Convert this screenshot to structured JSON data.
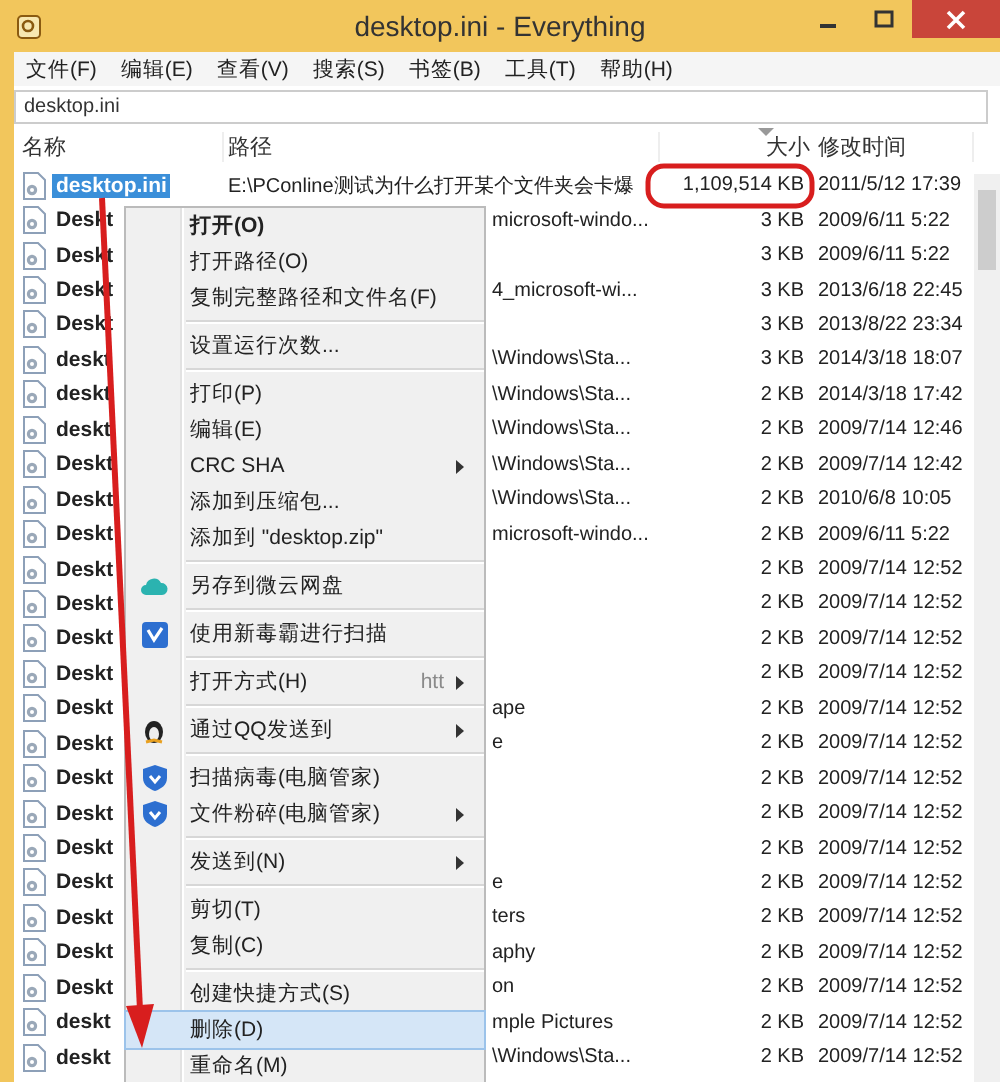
{
  "window": {
    "title": "desktop.ini - Everything"
  },
  "menu_bar": [
    "文件(F)",
    "编辑(E)",
    "查看(V)",
    "搜索(S)",
    "书签(B)",
    "工具(T)",
    "帮助(H)"
  ],
  "search": {
    "value": "desktop.ini"
  },
  "columns": [
    "名称",
    "路径",
    "大小",
    "修改时间"
  ],
  "rows": [
    {
      "name": "desktop.ini",
      "path": "E:\\PConline测试为什么打开某个文件夹会卡爆",
      "size": "1,109,514 KB",
      "modified": "2011/5/12 17:39",
      "selected": true
    },
    {
      "name": "Deskt",
      "path": "microsoft-windo...",
      "size": "3 KB",
      "modified": "2009/6/11 5:22",
      "selected": false
    },
    {
      "name": "Deskt",
      "size": "3 KB",
      "modified": "2009/6/11 5:22",
      "selected": false
    },
    {
      "name": "Deskt",
      "path": "4_microsoft-wi...",
      "size": "3 KB",
      "modified": "2013/6/18 22:45",
      "selected": false
    },
    {
      "name": "Deskt",
      "size": "3 KB",
      "modified": "2013/8/22 23:34",
      "selected": false
    },
    {
      "name": "deskt",
      "path": "\\Windows\\Sta...",
      "size": "3 KB",
      "modified": "2014/3/18 18:07",
      "selected": false
    },
    {
      "name": "deskt",
      "path": "\\Windows\\Sta...",
      "size": "2 KB",
      "modified": "2014/3/18 17:42",
      "selected": false
    },
    {
      "name": "deskt",
      "path": "\\Windows\\Sta...",
      "size": "2 KB",
      "modified": "2009/7/14 12:46",
      "selected": false
    },
    {
      "name": "Deskt",
      "path": "\\Windows\\Sta...",
      "size": "2 KB",
      "modified": "2009/7/14 12:42",
      "selected": false
    },
    {
      "name": "Deskt",
      "path": "\\Windows\\Sta...",
      "size": "2 KB",
      "modified": "2010/6/8 10:05",
      "selected": false
    },
    {
      "name": "Deskt",
      "path": "microsoft-windo...",
      "size": "2 KB",
      "modified": "2009/6/11 5:22",
      "selected": false
    },
    {
      "name": "Deskt",
      "size": "2 KB",
      "modified": "2009/7/14 12:52",
      "selected": false
    },
    {
      "name": "Deskt",
      "size": "2 KB",
      "modified": "2009/7/14 12:52",
      "selected": false
    },
    {
      "name": "Deskt",
      "size": "2 KB",
      "modified": "2009/7/14 12:52",
      "selected": false
    },
    {
      "name": "Deskt",
      "size": "2 KB",
      "modified": "2009/7/14 12:52",
      "selected": false
    },
    {
      "name": "Deskt",
      "path": "ape",
      "size": "2 KB",
      "modified": "2009/7/14 12:52",
      "selected": false
    },
    {
      "name": "Deskt",
      "path": "e",
      "size": "2 KB",
      "modified": "2009/7/14 12:52",
      "selected": false
    },
    {
      "name": "Deskt",
      "size": "2 KB",
      "modified": "2009/7/14 12:52",
      "selected": false
    },
    {
      "name": "Deskt",
      "size": "2 KB",
      "modified": "2009/7/14 12:52",
      "selected": false
    },
    {
      "name": "Deskt",
      "size": "2 KB",
      "modified": "2009/7/14 12:52",
      "selected": false
    },
    {
      "name": "Deskt",
      "path": "e",
      "size": "2 KB",
      "modified": "2009/7/14 12:52",
      "selected": false
    },
    {
      "name": "Deskt",
      "path": "ters",
      "size": "2 KB",
      "modified": "2009/7/14 12:52",
      "selected": false
    },
    {
      "name": "Deskt",
      "path": "aphy",
      "size": "2 KB",
      "modified": "2009/7/14 12:52",
      "selected": false
    },
    {
      "name": "Deskt",
      "path": "on",
      "size": "2 KB",
      "modified": "2009/7/14 12:52",
      "selected": false
    },
    {
      "name": "deskt",
      "path": "mple Pictures",
      "size": "2 KB",
      "modified": "2009/7/14 12:52",
      "selected": false
    },
    {
      "name": "deskt",
      "path": "\\Windows\\Sta...",
      "size": "2 KB",
      "modified": "2009/7/14 12:52",
      "selected": false
    }
  ],
  "context_menu": [
    {
      "kind": "item",
      "label": "打开(O)",
      "default": true,
      "submenu": false,
      "selected": false
    },
    {
      "kind": "item",
      "label": "打开路径(O)",
      "default": false,
      "submenu": false,
      "selected": false
    },
    {
      "kind": "item",
      "label": "复制完整路径和文件名(F)",
      "default": false,
      "submenu": false,
      "selected": false
    },
    {
      "kind": "separator"
    },
    {
      "kind": "item",
      "label": "设置运行次数...",
      "default": false,
      "submenu": false,
      "selected": false
    },
    {
      "kind": "separator"
    },
    {
      "kind": "item",
      "label": "打印(P)",
      "default": false,
      "submenu": false,
      "selected": false
    },
    {
      "kind": "item",
      "label": "编辑(E)",
      "default": false,
      "submenu": false,
      "selected": false
    },
    {
      "kind": "item",
      "label": "CRC SHA",
      "default": false,
      "submenu": true,
      "selected": false
    },
    {
      "kind": "item",
      "label": "添加到压缩包...",
      "default": false,
      "submenu": false,
      "selected": false
    },
    {
      "kind": "item",
      "label": "添加到 \"desktop.zip\"",
      "default": false,
      "submenu": false,
      "selected": false
    },
    {
      "kind": "separator"
    },
    {
      "kind": "cloud-item",
      "label": "另存到微云网盘",
      "default": false,
      "submenu": false,
      "selected": false
    },
    {
      "kind": "separator"
    },
    {
      "kind": "scan-item",
      "label": "使用新毒霸进行扫描",
      "default": false,
      "submenu": false,
      "selected": false
    },
    {
      "kind": "separator"
    },
    {
      "kind": "item",
      "label": "打开方式(H)",
      "hint": "htt",
      "default": false,
      "submenu": true,
      "selected": false
    },
    {
      "kind": "separator"
    },
    {
      "kind": "penguin-item",
      "label": "通过QQ发送到",
      "default": false,
      "submenu": true,
      "selected": false
    },
    {
      "kind": "separator"
    },
    {
      "kind": "shield-item",
      "label": "扫描病毒(电脑管家)",
      "default": false,
      "submenu": false,
      "selected": false
    },
    {
      "kind": "shield-item",
      "label": "文件粉碎(电脑管家)",
      "default": false,
      "submenu": true,
      "selected": false
    },
    {
      "kind": "separator"
    },
    {
      "kind": "item",
      "label": "发送到(N)",
      "default": false,
      "submenu": true,
      "selected": false
    },
    {
      "kind": "separator"
    },
    {
      "kind": "item",
      "label": "剪切(T)",
      "default": false,
      "submenu": false,
      "selected": false
    },
    {
      "kind": "item",
      "label": "复制(C)",
      "default": false,
      "submenu": false,
      "selected": false
    },
    {
      "kind": "separator"
    },
    {
      "kind": "item",
      "label": "创建快捷方式(S)",
      "default": false,
      "submenu": false,
      "selected": false
    },
    {
      "kind": "item",
      "label": "删除(D)",
      "default": false,
      "submenu": false,
      "selected": true
    },
    {
      "kind": "item",
      "label": "重命名(M)",
      "default": false,
      "submenu": false,
      "selected": false
    }
  ]
}
